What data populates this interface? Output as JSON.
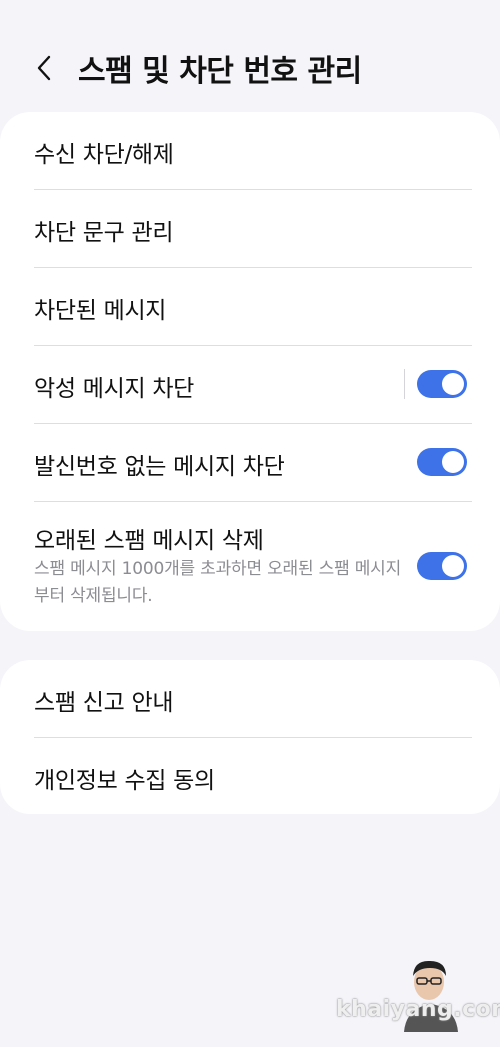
{
  "header": {
    "back_icon": "chevron-left-icon",
    "title": "스팸 및 차단 번호 관리"
  },
  "card1": {
    "items": [
      {
        "label": "수신 차단/해제"
      },
      {
        "label": "차단 문구 관리"
      },
      {
        "label": "차단된 메시지"
      },
      {
        "label": "악성 메시지 차단",
        "toggle": "on"
      },
      {
        "label": "발신번호 없는 메시지 차단",
        "toggle": "on"
      },
      {
        "label": "오래된 스팸 메시지 삭제",
        "description": "스팸 메시지 1000개를 초과하면 오래된 스팸 메시지부터 삭제됩니다.",
        "toggle": "on"
      }
    ]
  },
  "card2": {
    "items": [
      {
        "label": "스팸 신고 안내"
      },
      {
        "label": "개인정보 수집 동의"
      }
    ]
  },
  "colors": {
    "background": "#f4f4f9",
    "card": "#ffffff",
    "toggle_on": "#3e72e8",
    "description_text": "#8c8c93"
  },
  "watermark": {
    "text": "khaiyang.com"
  }
}
